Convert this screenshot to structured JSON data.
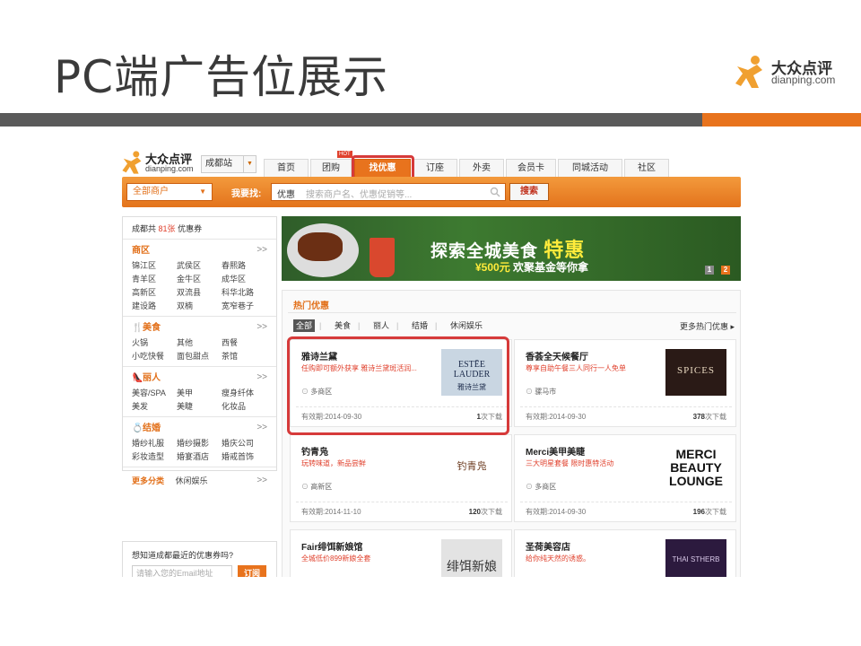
{
  "slide": {
    "title": "PC端广告位展示",
    "logo_cn": "大众点评",
    "logo_en": "dianping.com",
    "colors": {
      "gray_bar": "#5a5a5a",
      "orange_bar": "#e8731d"
    }
  },
  "site": {
    "logo_cn": "大众点评",
    "logo_en": "dianping.com",
    "city": "成都站",
    "nav_tabs": [
      "首页",
      "团购",
      "找优惠",
      "订座",
      "外卖",
      "会员卡",
      "同城活动",
      "社区"
    ],
    "active_tab": "找优惠",
    "hot_badge": "HOT",
    "search": {
      "category": "全部商户",
      "label": "我要找:",
      "type": "优惠",
      "placeholder": "搜索商户名、优惠促销等...",
      "button": "搜索"
    },
    "sidebar": {
      "summary_prefix": "成都共",
      "summary_count": "81张",
      "summary_suffix": "优惠券",
      "more_arrow": ">>",
      "sections": [
        {
          "title": "商区",
          "icon": "",
          "items": [
            "锦江区",
            "武侯区",
            "春熙路",
            "青羊区",
            "金牛区",
            "成华区",
            "高新区",
            "双流县",
            "科华北路",
            "建设路",
            "双楠",
            "宽窄巷子"
          ]
        },
        {
          "title": "美食",
          "icon": "fork-knife-icon",
          "items": [
            "火锅",
            "其他",
            "西餐",
            "小吃快餐",
            "面包甜点",
            "茶馆"
          ]
        },
        {
          "title": "丽人",
          "icon": "high-heel-icon",
          "items": [
            "美容/SPA",
            "美甲",
            "瘦身纤体",
            "美发",
            "美睫",
            "化妆品"
          ]
        },
        {
          "title": "结婚",
          "icon": "ring-icon",
          "items": [
            "婚纱礼服",
            "婚纱摄影",
            "婚庆公司",
            "彩妆造型",
            "婚宴酒店",
            "婚戒首饰"
          ]
        }
      ],
      "more_categories": "更多分类",
      "more_item": "休闲娱乐"
    },
    "email": {
      "prompt": "想知道成都最近的优惠券吗?",
      "placeholder": "请输入您的Email地址",
      "button": "订阅"
    },
    "banner": {
      "headline": "探索全城美食",
      "headline_highlight": "特惠",
      "sub_amount": "¥500元",
      "sub_text": "欢聚基金等你拿",
      "pages": [
        "1",
        "2"
      ]
    },
    "deals": {
      "title": "热门优惠",
      "filters": [
        "全部",
        "美食",
        "丽人",
        "结婚",
        "休闲娱乐"
      ],
      "more_link": "更多热门优惠 ▸",
      "cards": [
        {
          "name": "雅诗兰黛",
          "desc": "任购即可额外获享 雅诗兰黛斑活润...",
          "location": "多商区",
          "expiry": "有效期:2014-09-30",
          "downloads": "1",
          "dl_suffix": "次下载",
          "logo_text": "ESTĒE LAUDER",
          "logo_sub": "雅诗兰黛"
        },
        {
          "name": "香荟全天候餐厅",
          "desc": "尊享自助午餐三人同行一人免单",
          "location": "骡马市",
          "expiry": "有效期:2014-09-30",
          "downloads": "378",
          "dl_suffix": "次下载",
          "logo_text": "SPICES",
          "logo_sub": ""
        },
        {
          "name": "钓青凫",
          "desc": "玩转味道，新品尝鲜",
          "location": "高新区",
          "expiry": "有效期:2014-11-10",
          "downloads": "120",
          "dl_suffix": "次下载",
          "logo_text": "钓青凫",
          "logo_sub": ""
        },
        {
          "name": "Merci美甲美睫",
          "desc": "三大明星套餐 限时惠特活动",
          "location": "多商区",
          "expiry": "有效期:2014-09-30",
          "downloads": "196",
          "dl_suffix": "次下载",
          "logo_text": "MERCI BEAUTY LOUNGE",
          "logo_sub": ""
        },
        {
          "name": "Fair绯饵新娘馆",
          "desc": "全城低价899新娘全套",
          "location": "",
          "expiry": "",
          "downloads": "",
          "dl_suffix": "",
          "logo_text": "绯饵新娘馆",
          "logo_sub": ""
        },
        {
          "name": "圣荷美容店",
          "desc": "给你纯天然的诱惑。",
          "location": "",
          "expiry": "",
          "downloads": "",
          "dl_suffix": "",
          "logo_text": "THAI STHERB",
          "logo_sub": ""
        }
      ]
    }
  }
}
